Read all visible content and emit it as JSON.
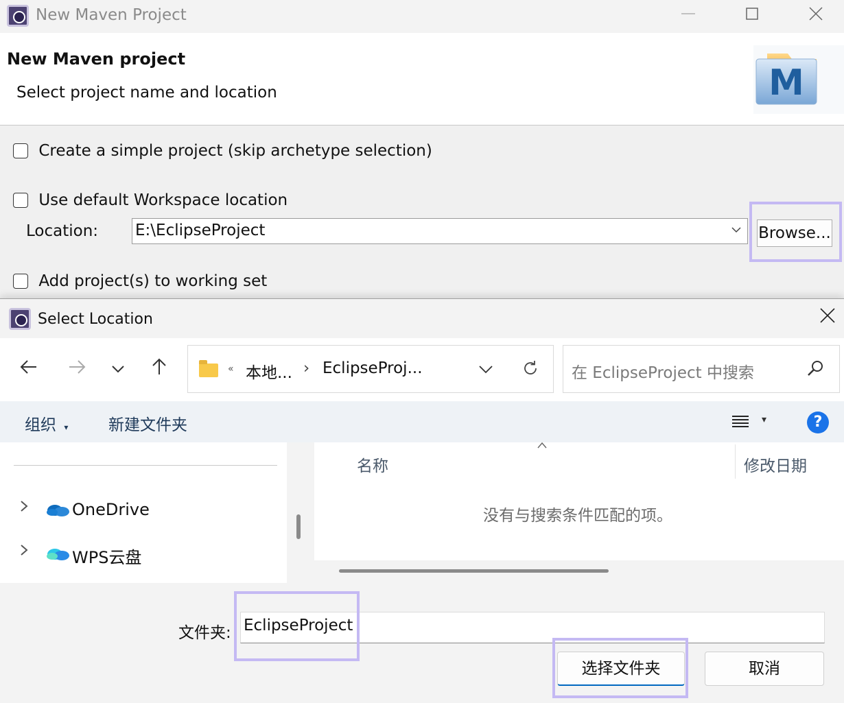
{
  "maven_window": {
    "title": "New Maven Project",
    "header_title": "New Maven project",
    "header_subtitle": "Select project name and location",
    "logo_letter": "M",
    "simple_project_label": "Create a simple project (skip archetype selection)",
    "default_workspace_label": "Use default Workspace location",
    "location_label": "Location:",
    "location_value": "E:\\EclipseProject",
    "browse_label": "Browse...",
    "working_set_label": "Add project(s) to working set"
  },
  "dialog": {
    "title": "Select Location",
    "breadcrumb_overflow": "«",
    "breadcrumb_1": "本地...",
    "breadcrumb_sep": "›",
    "breadcrumb_2": "EclipseProj...",
    "search_placeholder": "在 EclipseProject 中搜索",
    "organize_label": "组织",
    "new_folder_label": "新建文件夹",
    "help_label": "?",
    "tree_items": [
      {
        "label": "OneDrive"
      },
      {
        "label": "WPS云盘"
      }
    ],
    "col_name": "名称",
    "col_date": "修改日期",
    "empty_message": "没有与搜索条件匹配的项。",
    "folder_label": "文件夹:",
    "folder_value": "EclipseProject",
    "select_button": "选择文件夹",
    "cancel_button": "取消"
  },
  "colors": {
    "highlight": "#c4b9f3",
    "help_blue": "#1a73e8",
    "onedrive_blue": "#0f6cbd"
  }
}
